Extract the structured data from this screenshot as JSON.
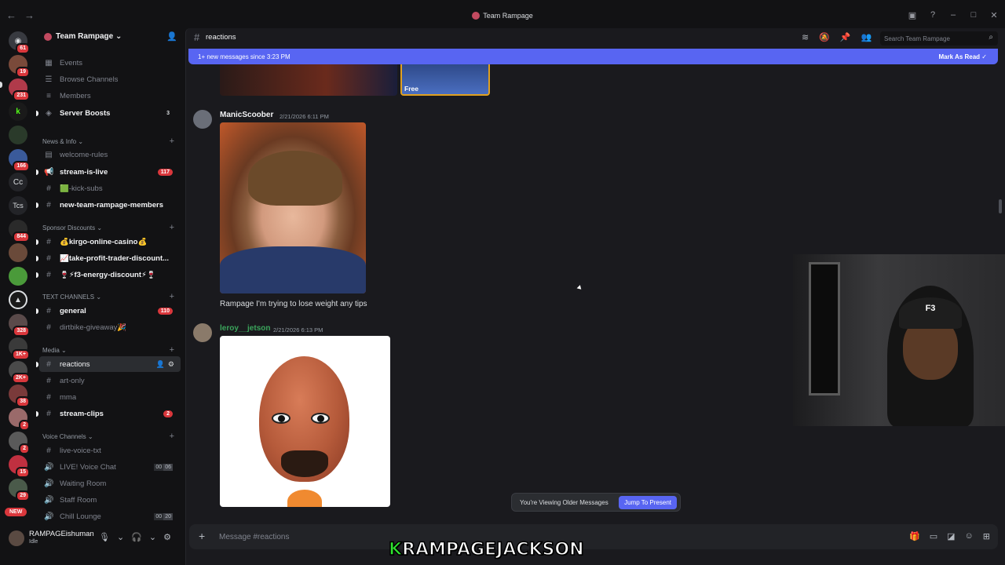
{
  "window": {
    "title": "Team Rampage"
  },
  "server": {
    "name": "Team Rampage"
  },
  "sidebar": {
    "top_items": [
      {
        "label": "Events",
        "icon": "calendar-icon"
      },
      {
        "label": "Browse Channels",
        "icon": "browse-icon"
      },
      {
        "label": "Members",
        "icon": "members-icon"
      },
      {
        "label": "Server Boosts",
        "icon": "boost-icon",
        "count": "3"
      }
    ],
    "categories": {
      "news": "News & Info",
      "sponsor": "Sponsor Discounts",
      "text": "TEXT CHANNELS",
      "media": "Media",
      "voice": "Voice Channels"
    },
    "news_channels": [
      {
        "label": "welcome-rules"
      },
      {
        "label": "stream-is-live",
        "count": "117"
      },
      {
        "label": "🟩-kick-subs"
      },
      {
        "label": "new-team-rampage-members"
      }
    ],
    "sponsor_channels": [
      {
        "label": "💰kirgo-online-casino💰"
      },
      {
        "label": "📈take-profit-trader-discount..."
      },
      {
        "label": "🍷⚡f3-energy-discount⚡🍷"
      }
    ],
    "text_channels": [
      {
        "label": "general",
        "count": "110"
      },
      {
        "label": "dirtbike-giveaway🎉"
      }
    ],
    "media_channels": [
      {
        "label": "reactions"
      },
      {
        "label": "art-only"
      },
      {
        "label": "mma"
      },
      {
        "label": "stream-clips",
        "count": "2"
      }
    ],
    "voice_channels": [
      {
        "label": "live-voice-txt"
      },
      {
        "label": "LIVE! Voice Chat",
        "a": "00",
        "b": "06"
      },
      {
        "label": "Waiting Room"
      },
      {
        "label": "Staff Room"
      },
      {
        "label": "Chill Lounge",
        "a": "00",
        "b": "20"
      }
    ]
  },
  "guild_badges": [
    "61",
    "19",
    "231",
    "166",
    "Cc",
    "Tcs",
    "844",
    "328",
    "1K+",
    "2K+",
    "38",
    "2",
    "2",
    "15",
    "29"
  ],
  "new_badge": "NEW",
  "user": {
    "name": "RAMPAGEishuman",
    "status": "Idle"
  },
  "channel": {
    "name": "reactions",
    "search_placeholder": "Search Team Rampage"
  },
  "new_messages": {
    "text": "1+ new messages since 3:23 PM",
    "action": "Mark As Read"
  },
  "media_free_label": "Free",
  "messages": [
    {
      "author": "ManicScoober",
      "time": "2/21/2026 6:11 PM",
      "text": "Rampage I'm trying to lose weight any tips",
      "color": "#f2f3f5"
    },
    {
      "author": "leroy__jetson",
      "time": "2/21/2026 6:13 PM",
      "text": "",
      "color": "#3ba55c"
    }
  ],
  "older_notice": {
    "text": "You're Viewing Older Messages",
    "button": "Jump To Present"
  },
  "composer": {
    "placeholder": "Message #reactions"
  },
  "webcam_cap": "F3",
  "overlay_caption": {
    "k": "K",
    "rest": "RAMPAGEJACKSON"
  },
  "colors": {
    "accent": "#5865f2",
    "danger": "#da373c",
    "online": "#3ba55c"
  }
}
